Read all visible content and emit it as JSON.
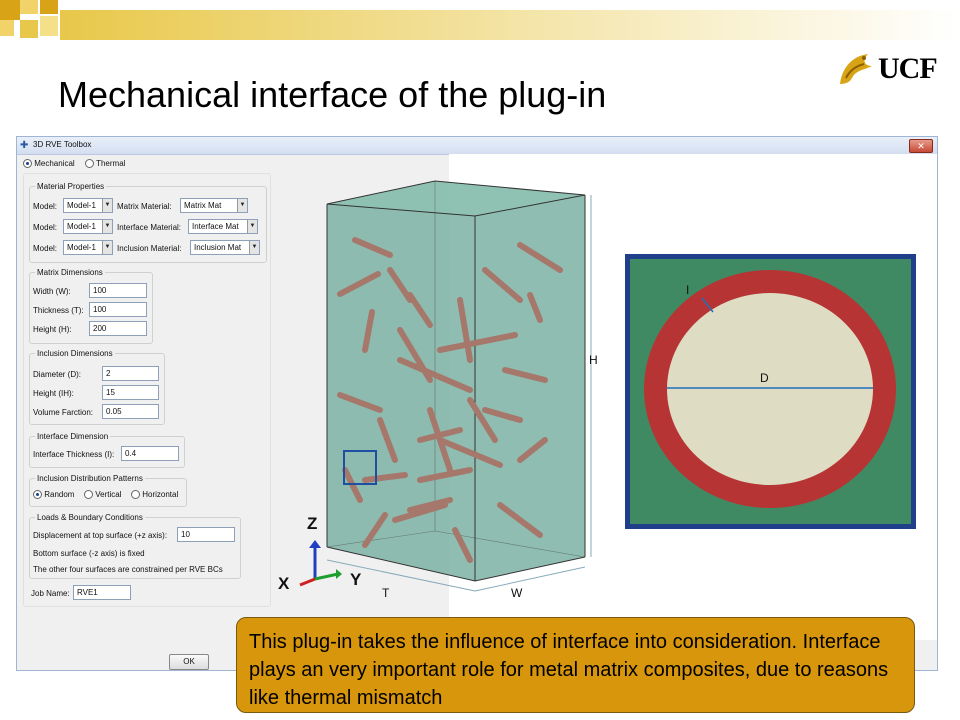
{
  "slide": {
    "title": "Mechanical interface of the plug-in",
    "logo_text": "UCF",
    "colors": {
      "banner": "#e8c84a",
      "callout": "#d7960b",
      "fiber": "#a5786b",
      "box": "#7db2a3"
    }
  },
  "window": {
    "title": "3D RVE Toolbox",
    "analysis_options": [
      {
        "label": "Mechanical",
        "selected": true
      },
      {
        "label": "Thermal",
        "selected": false
      }
    ],
    "material_properties": {
      "title": "Material Properties",
      "rows": [
        {
          "model_label": "Model:",
          "model_value": "Model-1",
          "material_label": "Matrix Material:",
          "material_value": "Matrix Mat"
        },
        {
          "model_label": "Model:",
          "model_value": "Model-1",
          "material_label": "Interface Material:",
          "material_value": "Interface Mat"
        },
        {
          "model_label": "Model:",
          "model_value": "Model-1",
          "material_label": "Inclusion Material:",
          "material_value": "Inclusion Mat"
        }
      ]
    },
    "matrix_dimensions": {
      "title": "Matrix Dimensions",
      "fields": [
        {
          "label": "Width (W):",
          "value": "100"
        },
        {
          "label": "Thickness (T):",
          "value": "100"
        },
        {
          "label": "Height (H):",
          "value": "200"
        }
      ]
    },
    "inclusion_dimensions": {
      "title": "Inclusion Dimensions",
      "fields": [
        {
          "label": "Diameter (D):",
          "value": "2"
        },
        {
          "label": "Height (IH):",
          "value": "15"
        },
        {
          "label": "Volume Farction:",
          "value": "0.05"
        }
      ]
    },
    "interface_dimension": {
      "title": "Interface Dimension",
      "label": "Interface Thickness (I):",
      "value": "0.4"
    },
    "distribution": {
      "title": "Inclusion Distribution Patterns",
      "options": [
        {
          "label": "Random",
          "selected": true
        },
        {
          "label": "Vertical",
          "selected": false
        },
        {
          "label": "Horizontal",
          "selected": false
        }
      ]
    },
    "loads": {
      "title": "Loads & Boundary Conditions",
      "displacement_label": "Displacement at top surface (+z axis):",
      "displacement_value": "10",
      "bottom_text": "Bottom surface  (-z axis) is fixed",
      "other_text": "The other four surfaces are constrained per RVE BCs"
    },
    "job_label": "Job Name:",
    "job_value": "RVE1",
    "ok_label": "OK"
  },
  "figure": {
    "dim_h": "H",
    "dim_t": "T",
    "dim_w": "W",
    "axis_z": "Z",
    "axis_x": "X",
    "axis_y": "Y",
    "detail_i": "I",
    "detail_d": "D"
  },
  "callout_text": "This plug-in takes the influence of interface into consideration. Interface plays an very important role for metal matrix composites, due to reasons like thermal mismatch"
}
